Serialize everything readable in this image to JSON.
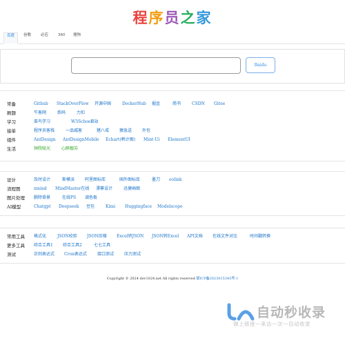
{
  "logo": {
    "chars": [
      "程",
      "序",
      "员",
      "之",
      "家"
    ],
    "colors": [
      "#e8413b",
      "#f39c12",
      "#9b59b6",
      "#27ae60",
      "#3498db"
    ]
  },
  "tabs": [
    {
      "label": "百度",
      "active": true
    },
    {
      "label": "谷歌",
      "active": false
    },
    {
      "label": "必应",
      "active": false
    },
    {
      "label": "360",
      "active": false
    },
    {
      "label": "搜狗",
      "active": false
    }
  ],
  "search": {
    "button_label": "Baidu",
    "placeholder": ""
  },
  "sections": [
    {
      "rows": [
        {
          "label": "常备",
          "links": [
            "Github",
            "StackOverFlow",
            "开源中国",
            "DockerHub",
            "掘金",
            "简书",
            "CSDN",
            "Gitee"
          ]
        },
        {
          "label": "刷题",
          "links": [
            "牛客网",
            "炼码",
            "力扣"
          ]
        },
        {
          "label": "学习",
          "links": [
            "菜鸟学习",
            "W3School",
            "B站"
          ]
        },
        {
          "label": "接单",
          "links": [
            "程序员客栈",
            "一品威客",
            "猪八戒",
            "猿急送",
            "外包"
          ]
        },
        {
          "label": "组件",
          "links": [
            "AntDesign",
            "AntDesignMobile",
            "Echart(韩计图)",
            "Mint-Ui",
            "ElementUI"
          ]
        },
        {
          "label": "生活",
          "links": [
            "钟院吸光",
            "心醉靓苏"
          ],
          "green": true
        }
      ]
    },
    {
      "rows": [
        {
          "label": "设计",
          "links": [
            "及时设计",
            "斯模派",
            "阿里图标库",
            "国外图标库",
            "墨刀",
            "eolink"
          ]
        },
        {
          "label": "流程图",
          "links": [
            "xmind",
            "MindMaster在线",
            "漂摹设计",
            "迅捷画图"
          ]
        },
        {
          "label": "图片处理",
          "links": [
            "删除背景",
            "在线PS",
            "调色板"
          ]
        },
        {
          "label": "AI模型",
          "links": [
            "Chatgpt",
            "Deepseek",
            "豆包",
            "Kimi",
            "Huggingface",
            "Modelscope"
          ]
        }
      ]
    },
    {
      "rows": [
        {
          "label": "常用工具",
          "links": [
            "格式化",
            "JSON校验",
            "JSON压缩",
            "Excel转JSON",
            "JSON转Excel",
            "API文档",
            "在线文件对比",
            "时间戳转换"
          ]
        },
        {
          "label": "更多工具",
          "links": [
            "综合工具1",
            "综合工具2",
            "七七工具"
          ]
        },
        {
          "label": "测试",
          "links": [
            "正则表达式",
            "Cron表达式",
            "接口测试",
            "压力测试"
          ]
        }
      ]
    }
  ],
  "footer": {
    "copyright": "Copyright © 2024 dev1024.net All rights reserved",
    "icp": "鄂ICP备2023015345号-1"
  },
  "watermark": {
    "title": "自动秒收录",
    "subtitle": "做上链接一来访一次一自动收录"
  }
}
